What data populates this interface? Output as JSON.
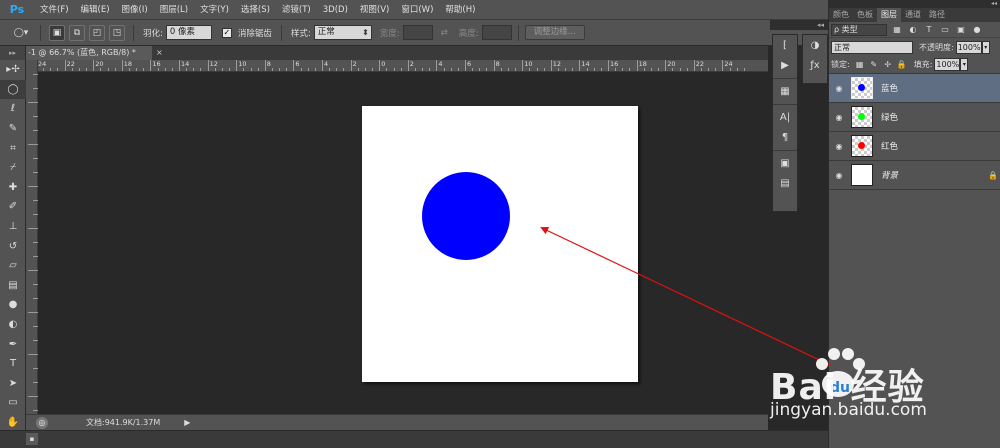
{
  "app": {
    "logo": "Ps"
  },
  "menu": [
    "文件(F)",
    "编辑(E)",
    "图像(I)",
    "图层(L)",
    "文字(Y)",
    "选择(S)",
    "滤镜(T)",
    "3D(D)",
    "视图(V)",
    "窗口(W)",
    "帮助(H)"
  ],
  "options": {
    "feather_label": "羽化:",
    "feather_value": "0 像素",
    "antialias_label": "消除锯齿",
    "antialias_checked": "✓",
    "style_label": "样式:",
    "style_value": "正常",
    "width_label": "宽度:",
    "height_label": "高度:",
    "refine_edge_label": "调整边缘..."
  },
  "document": {
    "tab_title": "-1 @ 66.7% (蓝色, RGB/8) *",
    "tab_close": "×",
    "doc_info": "文档:941.9K/1.37M",
    "circle_color": "#0000ff"
  },
  "ruler_labels": [
    "24",
    "22",
    "20",
    "18",
    "16",
    "14",
    "12",
    "10",
    "8",
    "6",
    "4",
    "2",
    "0",
    "2",
    "4",
    "6",
    "8",
    "10",
    "12",
    "14",
    "16",
    "18",
    "20",
    "22",
    "24"
  ],
  "tools": [
    "move-icon",
    "ellipse-marquee-icon",
    "lasso-icon",
    "quick-select-icon",
    "crop-icon",
    "eyedropper-icon",
    "healing-brush-icon",
    "brush-icon",
    "clone-stamp-icon",
    "history-brush-icon",
    "eraser-icon",
    "gradient-icon",
    "blur-icon",
    "dodge-icon",
    "pen-icon",
    "type-icon",
    "path-select-icon",
    "rectangle-icon",
    "hand-icon"
  ],
  "type_tool_glyph": "T",
  "layers_panel": {
    "tabs": [
      "颜色",
      "色板",
      "图层",
      "通道",
      "路径"
    ],
    "active_tab": 2,
    "filter_label": "ρ 类型",
    "blend_mode": "正常",
    "opacity_label": "不透明度:",
    "opacity_value": "100%",
    "lock_label": "锁定:",
    "fill_label": "填充:",
    "fill_value": "100%",
    "layers": [
      {
        "name": "蓝色",
        "dot_color": "#0000ff",
        "active": true
      },
      {
        "name": "绿色",
        "dot_color": "#00ff00",
        "active": false
      },
      {
        "name": "红色",
        "dot_color": "#ff0000",
        "active": false
      },
      {
        "name": "背景",
        "dot_color": "",
        "active": false
      }
    ]
  },
  "annotation": {
    "arrow_color": "#e01010"
  },
  "watermark": {
    "brand": "Bai 经验",
    "url": "jingyan.baidu.com"
  }
}
